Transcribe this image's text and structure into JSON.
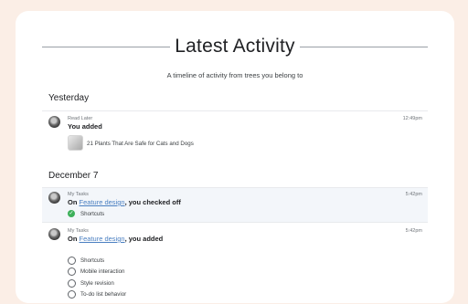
{
  "header": {
    "title": "Latest Activity",
    "subtitle": "A timeline of activity from trees you belong to"
  },
  "sections": [
    {
      "heading": "Yesterday",
      "entries": [
        {
          "tree": "Read Later",
          "action": "You added",
          "time": "12:49pm",
          "item": "21 Plants That Are Safe for Cats and Dogs"
        }
      ]
    },
    {
      "heading": "December 7",
      "entries": [
        {
          "tree": "My Tasks",
          "prefix": "On",
          "link": "Feature design",
          "suffix": ", you checked off",
          "time": "5:42pm",
          "items": [
            "Shortcuts"
          ]
        },
        {
          "tree": "My Tasks",
          "prefix": "On",
          "link": "Feature design",
          "suffix": ", you added",
          "time": "5:42pm",
          "items": [
            "Shortcuts",
            "Mobile interaction",
            "Style revision",
            "To-do list behavior"
          ]
        }
      ]
    }
  ],
  "colors": {
    "background": "#fbeee6",
    "card": "#ffffff",
    "check": "#3db05a",
    "link": "#4a7fc1"
  },
  "icons": {
    "avatar": "user-avatar",
    "checked": "check-circle-icon",
    "unchecked": "empty-circle-icon"
  }
}
